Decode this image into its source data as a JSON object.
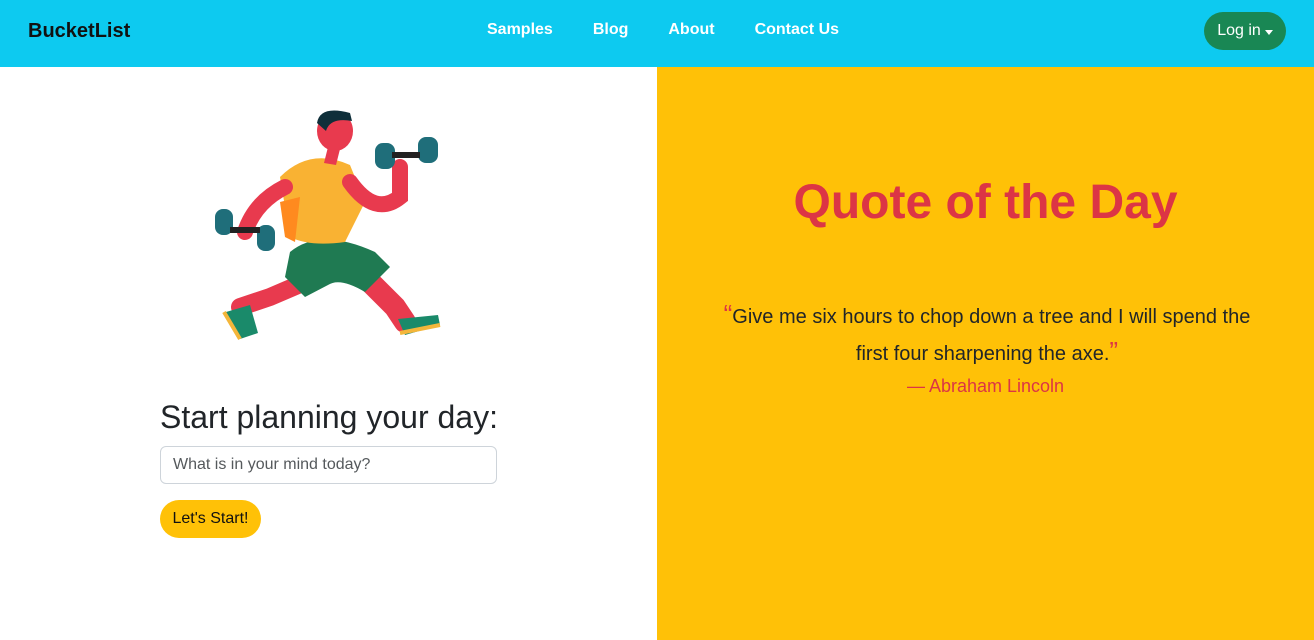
{
  "navbar": {
    "brand": "BucketList",
    "links": [
      "Samples",
      "Blog",
      "About",
      "Contact Us"
    ],
    "login_label": "Log in"
  },
  "planner": {
    "illustration": "running-man-with-dumbbells",
    "heading": "Start planning your day:",
    "input_placeholder": "What is in your mind today?",
    "input_value": "",
    "button_label": "Let's Start!"
  },
  "quote": {
    "title": "Quote of the Day",
    "open_mark": "“",
    "text": "Give me six hours to chop down a tree and I will spend the first four sharpening the axe.",
    "close_mark": "”",
    "author": "— Abraham Lincoln"
  },
  "colors": {
    "navbar_bg": "#0dcaf0",
    "login_bg": "#198754",
    "accent_yellow": "#ffc107",
    "quote_red": "#dc3545"
  }
}
